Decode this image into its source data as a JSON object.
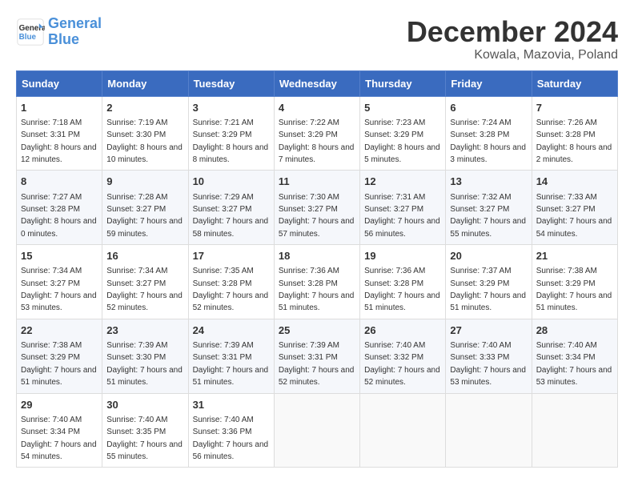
{
  "header": {
    "logo_line1": "General",
    "logo_line2": "Blue",
    "month": "December 2024",
    "location": "Kowala, Mazovia, Poland"
  },
  "days_of_week": [
    "Sunday",
    "Monday",
    "Tuesday",
    "Wednesday",
    "Thursday",
    "Friday",
    "Saturday"
  ],
  "weeks": [
    [
      {
        "day": "1",
        "sunrise": "7:18 AM",
        "sunset": "3:31 PM",
        "daylight": "8 hours and 12 minutes."
      },
      {
        "day": "2",
        "sunrise": "7:19 AM",
        "sunset": "3:30 PM",
        "daylight": "8 hours and 10 minutes."
      },
      {
        "day": "3",
        "sunrise": "7:21 AM",
        "sunset": "3:29 PM",
        "daylight": "8 hours and 8 minutes."
      },
      {
        "day": "4",
        "sunrise": "7:22 AM",
        "sunset": "3:29 PM",
        "daylight": "8 hours and 7 minutes."
      },
      {
        "day": "5",
        "sunrise": "7:23 AM",
        "sunset": "3:29 PM",
        "daylight": "8 hours and 5 minutes."
      },
      {
        "day": "6",
        "sunrise": "7:24 AM",
        "sunset": "3:28 PM",
        "daylight": "8 hours and 3 minutes."
      },
      {
        "day": "7",
        "sunrise": "7:26 AM",
        "sunset": "3:28 PM",
        "daylight": "8 hours and 2 minutes."
      }
    ],
    [
      {
        "day": "8",
        "sunrise": "7:27 AM",
        "sunset": "3:28 PM",
        "daylight": "8 hours and 0 minutes."
      },
      {
        "day": "9",
        "sunrise": "7:28 AM",
        "sunset": "3:27 PM",
        "daylight": "7 hours and 59 minutes."
      },
      {
        "day": "10",
        "sunrise": "7:29 AM",
        "sunset": "3:27 PM",
        "daylight": "7 hours and 58 minutes."
      },
      {
        "day": "11",
        "sunrise": "7:30 AM",
        "sunset": "3:27 PM",
        "daylight": "7 hours and 57 minutes."
      },
      {
        "day": "12",
        "sunrise": "7:31 AM",
        "sunset": "3:27 PM",
        "daylight": "7 hours and 56 minutes."
      },
      {
        "day": "13",
        "sunrise": "7:32 AM",
        "sunset": "3:27 PM",
        "daylight": "7 hours and 55 minutes."
      },
      {
        "day": "14",
        "sunrise": "7:33 AM",
        "sunset": "3:27 PM",
        "daylight": "7 hours and 54 minutes."
      }
    ],
    [
      {
        "day": "15",
        "sunrise": "7:34 AM",
        "sunset": "3:27 PM",
        "daylight": "7 hours and 53 minutes."
      },
      {
        "day": "16",
        "sunrise": "7:34 AM",
        "sunset": "3:27 PM",
        "daylight": "7 hours and 52 minutes."
      },
      {
        "day": "17",
        "sunrise": "7:35 AM",
        "sunset": "3:28 PM",
        "daylight": "7 hours and 52 minutes."
      },
      {
        "day": "18",
        "sunrise": "7:36 AM",
        "sunset": "3:28 PM",
        "daylight": "7 hours and 51 minutes."
      },
      {
        "day": "19",
        "sunrise": "7:36 AM",
        "sunset": "3:28 PM",
        "daylight": "7 hours and 51 minutes."
      },
      {
        "day": "20",
        "sunrise": "7:37 AM",
        "sunset": "3:29 PM",
        "daylight": "7 hours and 51 minutes."
      },
      {
        "day": "21",
        "sunrise": "7:38 AM",
        "sunset": "3:29 PM",
        "daylight": "7 hours and 51 minutes."
      }
    ],
    [
      {
        "day": "22",
        "sunrise": "7:38 AM",
        "sunset": "3:29 PM",
        "daylight": "7 hours and 51 minutes."
      },
      {
        "day": "23",
        "sunrise": "7:39 AM",
        "sunset": "3:30 PM",
        "daylight": "7 hours and 51 minutes."
      },
      {
        "day": "24",
        "sunrise": "7:39 AM",
        "sunset": "3:31 PM",
        "daylight": "7 hours and 51 minutes."
      },
      {
        "day": "25",
        "sunrise": "7:39 AM",
        "sunset": "3:31 PM",
        "daylight": "7 hours and 52 minutes."
      },
      {
        "day": "26",
        "sunrise": "7:40 AM",
        "sunset": "3:32 PM",
        "daylight": "7 hours and 52 minutes."
      },
      {
        "day": "27",
        "sunrise": "7:40 AM",
        "sunset": "3:33 PM",
        "daylight": "7 hours and 53 minutes."
      },
      {
        "day": "28",
        "sunrise": "7:40 AM",
        "sunset": "3:34 PM",
        "daylight": "7 hours and 53 minutes."
      }
    ],
    [
      {
        "day": "29",
        "sunrise": "7:40 AM",
        "sunset": "3:34 PM",
        "daylight": "7 hours and 54 minutes."
      },
      {
        "day": "30",
        "sunrise": "7:40 AM",
        "sunset": "3:35 PM",
        "daylight": "7 hours and 55 minutes."
      },
      {
        "day": "31",
        "sunrise": "7:40 AM",
        "sunset": "3:36 PM",
        "daylight": "7 hours and 56 minutes."
      },
      null,
      null,
      null,
      null
    ]
  ]
}
